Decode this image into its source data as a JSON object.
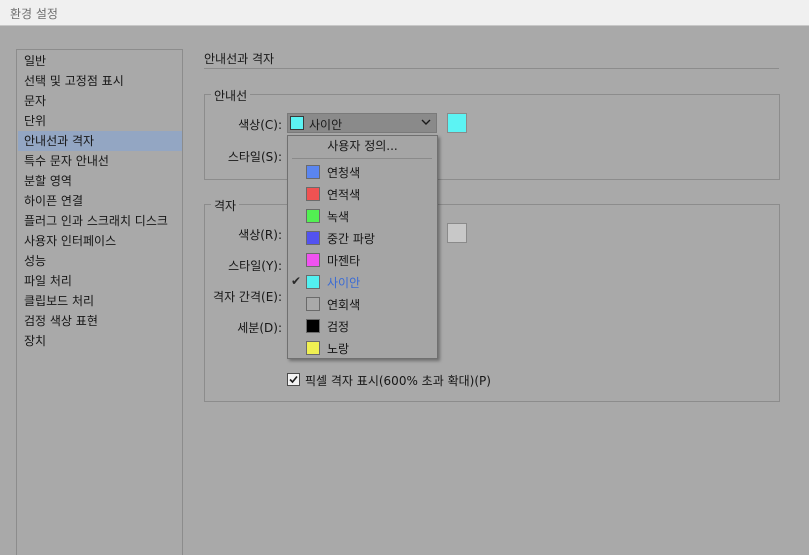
{
  "window": {
    "title": "환경 설정"
  },
  "sidebar": {
    "items": [
      {
        "label": "일반"
      },
      {
        "label": "선택 및 고정점 표시"
      },
      {
        "label": "문자"
      },
      {
        "label": "단위"
      },
      {
        "label": "안내선과 격자",
        "selected": true
      },
      {
        "label": "특수 문자 안내선"
      },
      {
        "label": "분할 영역"
      },
      {
        "label": "하이픈 연결"
      },
      {
        "label": "플러그 인과 스크래치 디스크"
      },
      {
        "label": "사용자 인터페이스"
      },
      {
        "label": "성능"
      },
      {
        "label": "파일 처리"
      },
      {
        "label": "클립보드 처리"
      },
      {
        "label": "검정 색상 표현"
      },
      {
        "label": "장치"
      }
    ]
  },
  "main": {
    "section_title": "안내선과 격자",
    "guides": {
      "group_title": "안내선",
      "color_label": "색상(C):",
      "color_value": "사이안",
      "color_swatch": "#5cf3f3",
      "style_label": "스타일(S):"
    },
    "grid": {
      "group_title": "격자",
      "color_label": "색상(R):",
      "color_swatch": "#c8c8c8",
      "style_label": "스타일(Y):",
      "spacing_label": "격자 간격(E):",
      "subdivisions_label": "세분(D):",
      "pixel_grid_label": "픽셀 격자 표시(600% 초과 확대)(P)",
      "pixel_grid_checked": true
    }
  },
  "color_dropdown": {
    "custom_label": "사용자 정의...",
    "options": [
      {
        "label": "연청색",
        "color": "#5a85f0"
      },
      {
        "label": "연적색",
        "color": "#f05252"
      },
      {
        "label": "녹색",
        "color": "#52f052"
      },
      {
        "label": "중간 파랑",
        "color": "#5252f0"
      },
      {
        "label": "마젠타",
        "color": "#f052f0"
      },
      {
        "label": "사이안",
        "color": "#52f0f0",
        "selected": true
      },
      {
        "label": "연회색",
        "color": "#a9a9a9"
      },
      {
        "label": "검정",
        "color": "#000000"
      },
      {
        "label": "노랑",
        "color": "#f0f052"
      }
    ]
  }
}
